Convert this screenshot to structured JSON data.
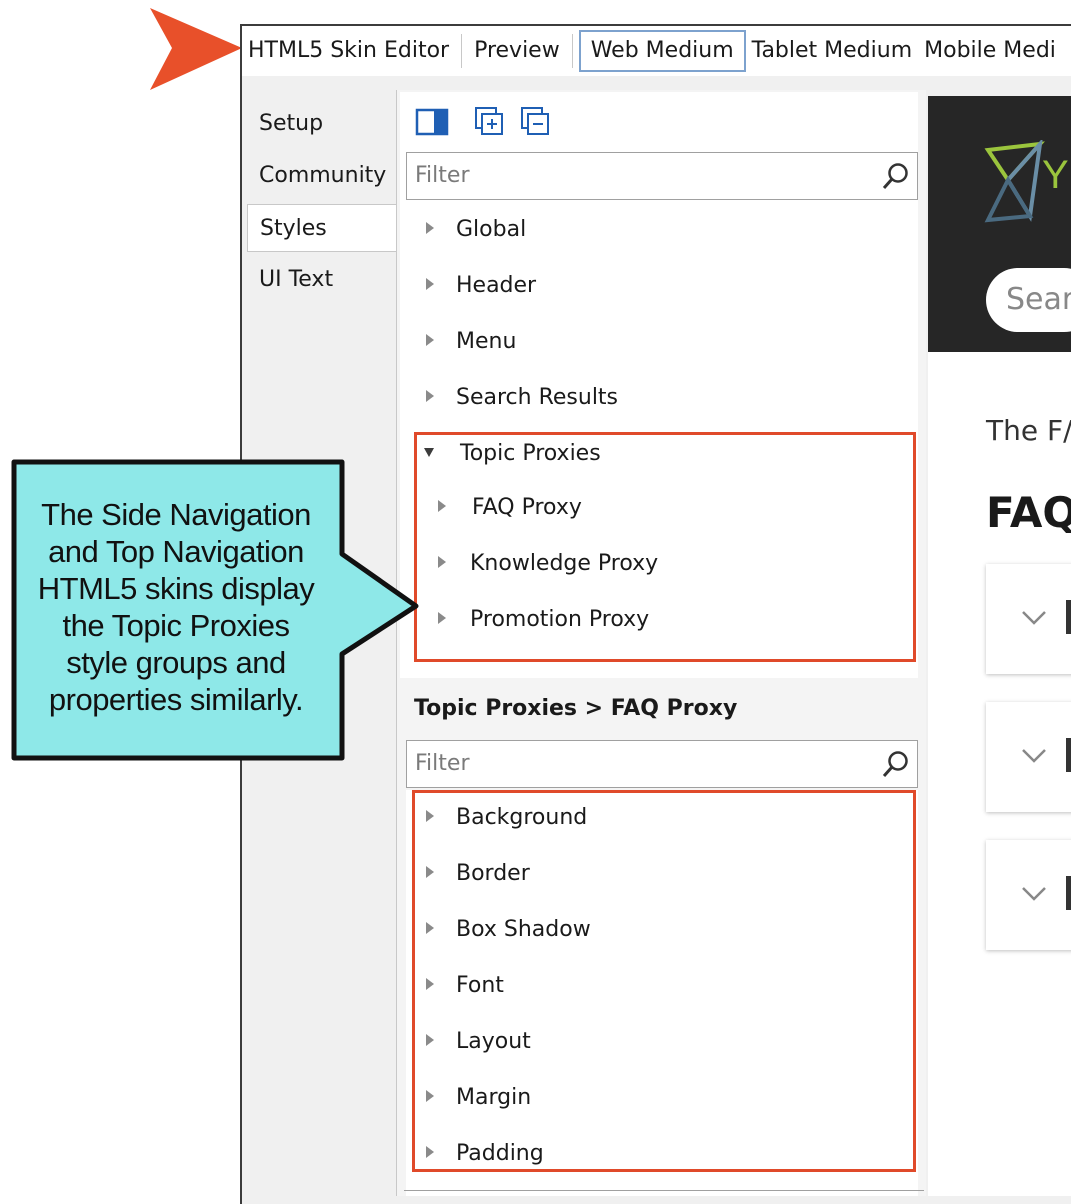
{
  "toolbar": {
    "items": [
      "HTML5 Skin Editor",
      "Preview",
      "Web Medium",
      "Tablet Medium",
      "Mobile Medi"
    ]
  },
  "tabs": [
    "Setup",
    "Community",
    "Styles",
    "UI Text"
  ],
  "styles_panel": {
    "filter_placeholder": "Filter",
    "groups": [
      "Global",
      "Header",
      "Menu",
      "Search Results",
      "Topic Proxies"
    ],
    "topic_proxies_children": [
      "FAQ Proxy",
      "Knowledge Proxy",
      "Promotion Proxy"
    ]
  },
  "properties_panel": {
    "breadcrumb": "Topic Proxies > FAQ Proxy",
    "filter_placeholder": "Filter",
    "items": [
      "Background",
      "Border",
      "Box Shadow",
      "Font",
      "Layout",
      "Margin",
      "Padding"
    ]
  },
  "preview": {
    "logo_letter": "Y",
    "search_placeholder": "Sear",
    "intro_text": "The F/",
    "heading": "FAQ"
  },
  "callout": {
    "lines": [
      "The Side Navigation",
      "and Top Navigation",
      "HTML5 skins display",
      "the Topic Proxies",
      "style groups and",
      "properties similarly."
    ]
  },
  "colors": {
    "accent_orange": "#e8502a",
    "highlight_red": "#e04a2a",
    "callout_fill": "#8ee8e8",
    "active_tab_border": "#7da2ce",
    "preview_header": "#262626"
  }
}
